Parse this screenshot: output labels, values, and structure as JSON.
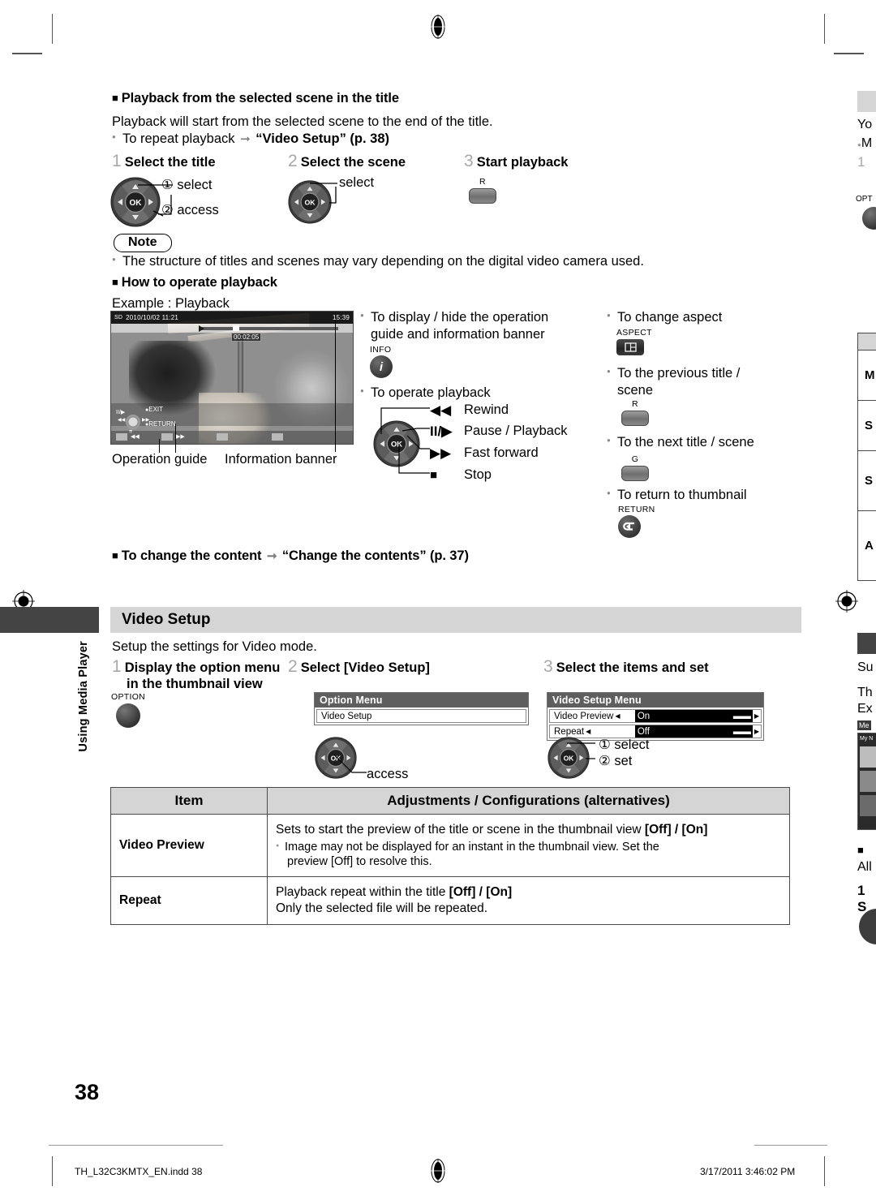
{
  "section1": {
    "heading": "Playback from the selected scene in the title",
    "intro": "Playback will start from the selected scene to the end of the title.",
    "bullet_repeat_pre": "To repeat playback",
    "bullet_repeat_link": "“Video Setup” (p. 38)",
    "steps": [
      {
        "num": "1",
        "label": "Select the title",
        "callout1": "① select",
        "callout2": "② access"
      },
      {
        "num": "2",
        "label": "Select the scene",
        "callout1": "select"
      },
      {
        "num": "3",
        "label": "Start playback",
        "button": "R"
      }
    ]
  },
  "note": {
    "label": "Note",
    "text": "The structure of titles and scenes may vary depending on the digital video camera used."
  },
  "section2": {
    "heading": "How to operate playback",
    "example_label": "Example : Playback",
    "tv": {
      "card": "SD",
      "date": "2010/10/02  11:21",
      "elapsed": "00:02:05",
      "total": "15:39",
      "guide_play": "II/▶",
      "guide_rew": "◀◀",
      "guide_ff": "▶▶",
      "guide_stop": "■",
      "guide_exit": "EXIT",
      "guide_return": "RETURN"
    },
    "caption_left": "Operation guide",
    "caption_right": "Information banner",
    "col_mid": {
      "b1_line1": "To display / hide the operation",
      "b1_line2": "guide and information banner",
      "info_label": "INFO",
      "info_glyph": "i",
      "b2": "To operate playback",
      "ops": [
        {
          "glyph": "◀◀",
          "label": "Rewind"
        },
        {
          "glyph": "II/▶",
          "label": "Pause / Playback"
        },
        {
          "glyph": "▶▶",
          "label": "Fast forward"
        },
        {
          "glyph": "■",
          "label": "Stop"
        }
      ]
    },
    "col_right": [
      {
        "text": "To change aspect",
        "btn_label": "ASPECT",
        "btn_type": "aspect"
      },
      {
        "text": "To the previous title /",
        "text2": "scene",
        "btn_label": "R",
        "btn_type": "color"
      },
      {
        "text": "To the next title / scene",
        "btn_label": "G",
        "btn_type": "color"
      },
      {
        "text": "To return to thumbnail",
        "btn_label": "RETURN",
        "btn_type": "return"
      }
    ]
  },
  "section3": {
    "heading_pre": "To change the content",
    "heading_link": "“Change the contents” (p. 37)"
  },
  "videosetup": {
    "band_title": "Video Setup",
    "side_tab_text": "Using Media Player",
    "intro": "Setup the settings for Video mode.",
    "steps": [
      {
        "num": "1",
        "label": "Display the option menu",
        "label2": "in the thumbnail view",
        "btn_label": "OPTION"
      },
      {
        "num": "2",
        "label": "Select [Video Setup]",
        "callout": "access"
      },
      {
        "num": "3",
        "label": "Select the items and set",
        "callout1": "① select",
        "callout2": "② set"
      }
    ],
    "option_menu": {
      "title": "Option Menu",
      "rows": [
        {
          "label": "Video Setup"
        }
      ]
    },
    "video_setup_menu": {
      "title": "Video Setup Menu",
      "rows": [
        {
          "label": "Video Preview",
          "value": "On"
        },
        {
          "label": "Repeat",
          "value": "Off"
        }
      ]
    }
  },
  "table": {
    "headers": [
      "Item",
      "Adjustments / Configurations (alternatives)"
    ],
    "rows": [
      {
        "item": "Video Preview",
        "line1_pre": "Sets to start the preview of the title or scene in the thumbnail view ",
        "line1_bold": "[Off] / [On]",
        "bullet_l1": "Image may not be displayed for an instant in the thumbnail view. Set the",
        "bullet_l2": "preview [Off] to resolve this."
      },
      {
        "item": "Repeat",
        "line1_pre": "Playback repeat within the title ",
        "line1_bold": "[Off] / [On]",
        "line2": "Only the selected file will be repeated."
      }
    ]
  },
  "bleed_right": {
    "line1": "Yo",
    "line2": "M",
    "line3": "1",
    "line4": "OPT",
    "tbl": [
      "M",
      "S",
      "S",
      "A"
    ],
    "b1": "Su",
    "b2": "Th",
    "b3": "Ex",
    "b4": "Me",
    "b5": "My N",
    "b6": "All",
    "b7": "1 S"
  },
  "footer": {
    "page_number": "38",
    "file_name": "TH_L32C3KMTX_EN.indd   38",
    "timestamp": "3/17/2011   3:46:02 PM"
  }
}
